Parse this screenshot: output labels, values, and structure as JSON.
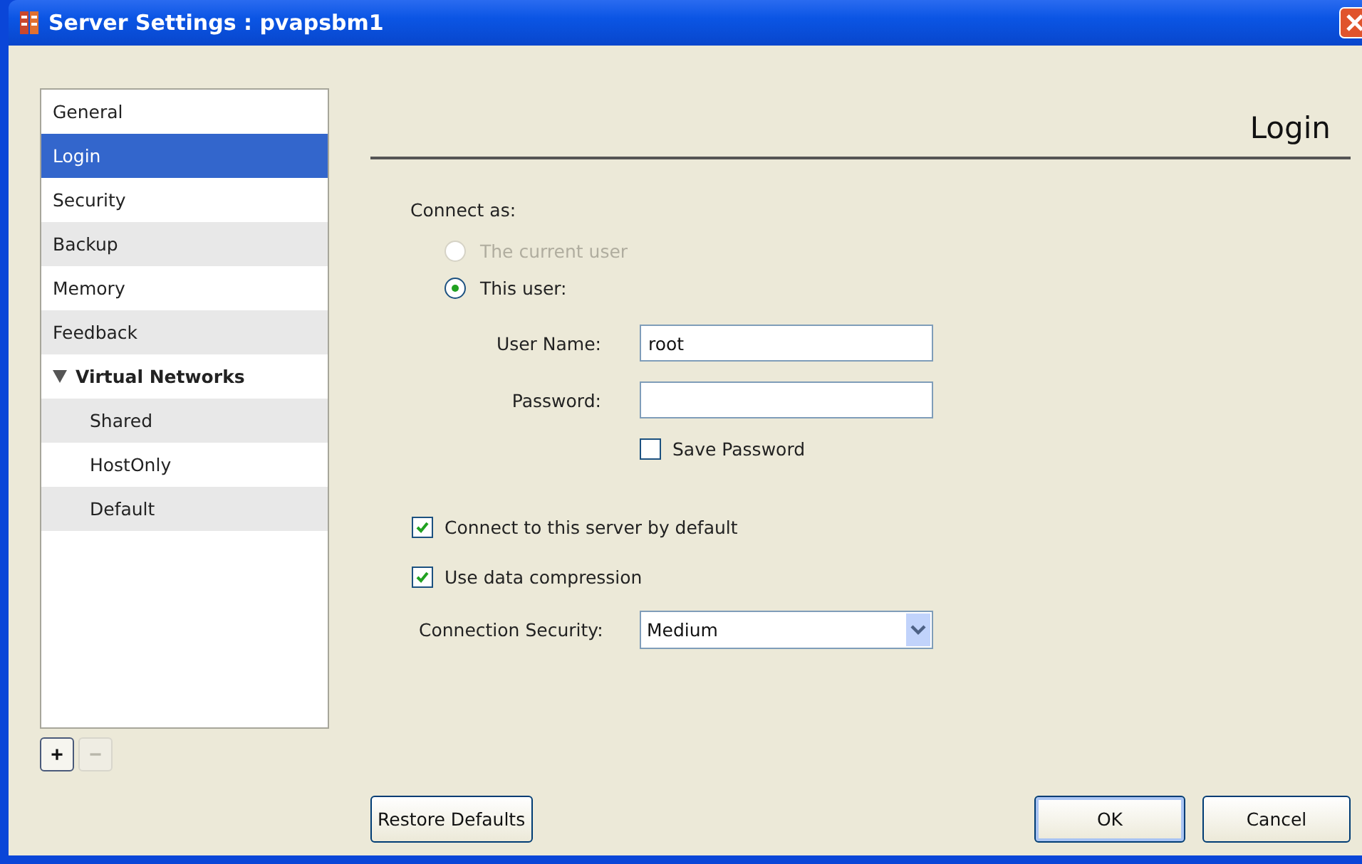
{
  "window": {
    "title": "Server Settings : pvapsbm1"
  },
  "sidebar": {
    "items": [
      {
        "label": "General",
        "selected": false
      },
      {
        "label": "Login",
        "selected": true
      },
      {
        "label": "Security",
        "selected": false
      },
      {
        "label": "Backup",
        "selected": false
      },
      {
        "label": "Memory",
        "selected": false
      },
      {
        "label": "Feedback",
        "selected": false
      },
      {
        "label": "Virtual Networks",
        "selected": false,
        "expanded": true,
        "children": [
          {
            "label": "Shared",
            "selected": false
          },
          {
            "label": "HostOnly",
            "selected": false
          },
          {
            "label": "Default",
            "selected": false
          }
        ]
      }
    ],
    "buttons": [
      {
        "label": "+",
        "disabled": false
      },
      {
        "label": "−",
        "disabled": true
      }
    ]
  },
  "panel": {
    "heading": "Login",
    "connect_as": {
      "label": "Connect as:",
      "options": [
        {
          "label": "The current user",
          "selected": false,
          "disabled": true
        },
        {
          "label": "This user:",
          "selected": true,
          "disabled": false
        }
      ]
    },
    "user_name": {
      "label": "User Name:",
      "value": "root"
    },
    "password": {
      "label": "Password:"
    },
    "save_password": {
      "label": "Save Password",
      "checked": false
    },
    "options": [
      {
        "label": "Connect to this server by default",
        "checked": true
      },
      {
        "label": "Use data compression",
        "checked": true
      }
    ],
    "connection_security": {
      "label": "Connection Security:",
      "value": "Medium"
    }
  },
  "buttons": {
    "restore": "Restore Defaults",
    "ok": "OK",
    "cancel": "Cancel"
  }
}
